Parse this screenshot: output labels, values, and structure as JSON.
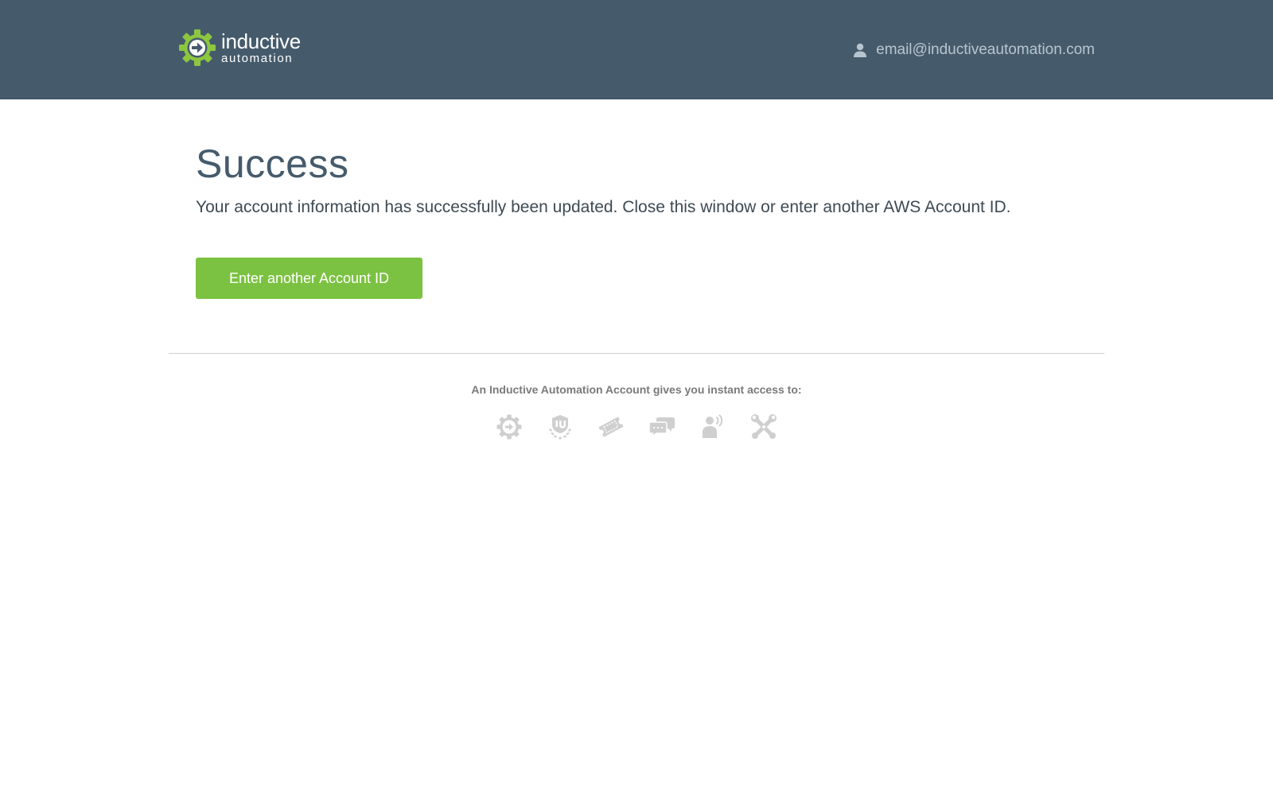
{
  "header": {
    "logo": {
      "line1": "inductive",
      "line2": "automation",
      "brand_color": "#8dc63f",
      "icon": "gear-arrow-icon"
    },
    "user": {
      "icon": "user-icon",
      "email": "email@inductiveautomation.com"
    },
    "background": "#455b6c"
  },
  "main": {
    "title": "Success",
    "message": "Your account information has successfully been updated. Close this window or enter another AWS Account ID.",
    "button_label": "Enter another Account ID",
    "button_color": "#7cc242"
  },
  "footer": {
    "access_text": "An Inductive Automation Account gives you instant access to:",
    "icons": [
      "gear-arrow-icon",
      "inductive-university-badge-icon",
      "ticket-icon",
      "chat-bubbles-icon",
      "person-speaking-icon",
      "crossed-tools-icon"
    ],
    "icon_color": "#cfcfcf"
  }
}
